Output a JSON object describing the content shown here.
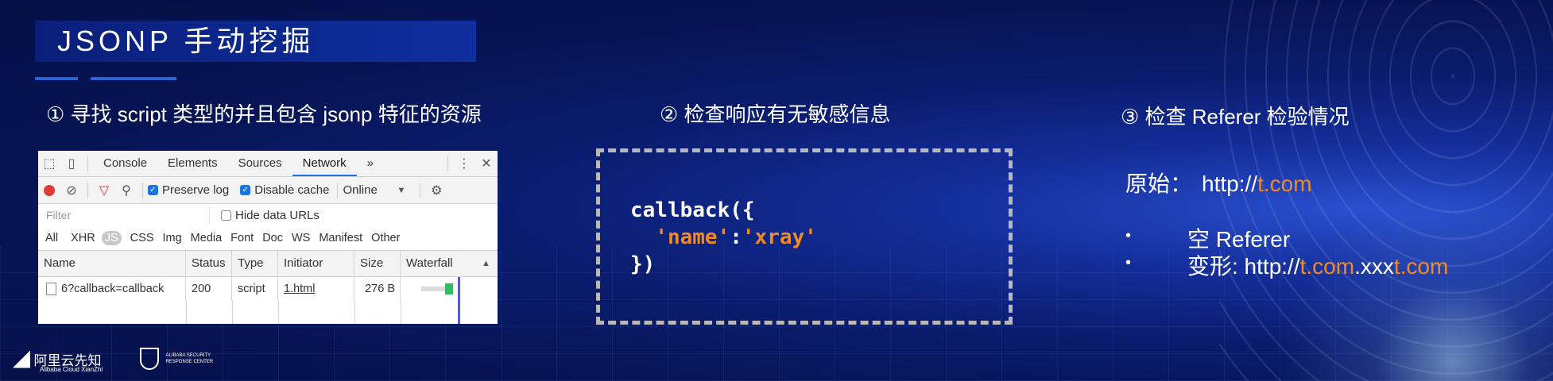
{
  "title": "JSONP 手动挖掘",
  "sections": {
    "s1": "① 寻找 script 类型的并且包含 jsonp 特征的资源",
    "s2": "② 检查响应有无敏感信息",
    "s3": "③ 检查 Referer 检验情况"
  },
  "devtools": {
    "tabs": [
      "Console",
      "Elements",
      "Sources",
      "Network",
      "»"
    ],
    "active_tab": "Network",
    "toolbar": {
      "preserve_log": "Preserve log",
      "disable_cache": "Disable cache",
      "throttle": "Online"
    },
    "filter_placeholder": "Filter",
    "hide_data_urls": "Hide data URLs",
    "types": [
      "All",
      "XHR",
      "JS",
      "CSS",
      "Img",
      "Media",
      "Font",
      "Doc",
      "WS",
      "Manifest",
      "Other"
    ],
    "selected_type": "JS",
    "columns": [
      "Name",
      "Status",
      "Type",
      "Initiator",
      "Size",
      "Waterfall"
    ],
    "rows": [
      {
        "name": "6?callback=callback",
        "status": "200",
        "type": "script",
        "initiator": "1.html",
        "size": "276 B"
      }
    ]
  },
  "code": {
    "line1": "callback({",
    "key": "'name'",
    "colon": ":",
    "value": "'xray'",
    "line3": "})"
  },
  "referer": {
    "original_label": "原始：",
    "original_prefix": "http://",
    "original_host": "t.com",
    "bullet1": "空 Referer",
    "bullet2_label": "变形: http://",
    "bullet2_host1": "t.com",
    "bullet2_mid": ".xxx",
    "bullet2_host2": "t.com"
  },
  "footer": {
    "brand_cn": "阿里云先知",
    "brand_en": "Alibaba Cloud XianZhi",
    "asrc_line1": "ALIBABA SECURITY",
    "asrc_line2": "RESPONSE CENTER"
  },
  "colors": {
    "accent_orange": "#f08a24",
    "bg_navy": "#071454",
    "title_blue": "#0e2f9e"
  }
}
